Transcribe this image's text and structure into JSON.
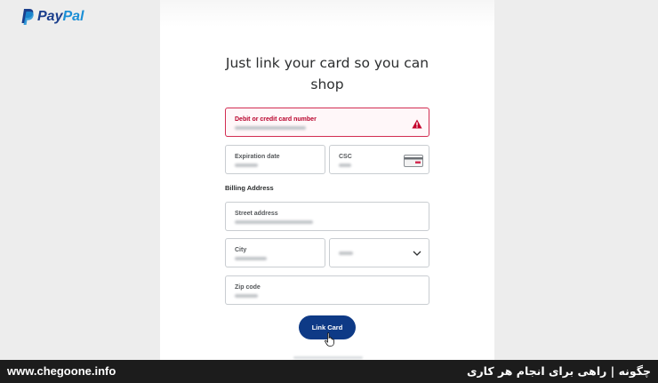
{
  "brand": {
    "name_part1": "Pay",
    "name_part2": "Pal",
    "color_dark": "#1a3e8c",
    "color_light": "#1b8fd6"
  },
  "form": {
    "heading_line1": "Just link your card so you can",
    "heading_line2": "shop",
    "card_number": {
      "label": "Debit or credit card number",
      "state": "error",
      "value_obscured": true,
      "icon": "warning-icon"
    },
    "expiration": {
      "label": "Expiration date",
      "value_obscured": true
    },
    "csc": {
      "label": "CSC",
      "value_obscured": true,
      "icon": "card-back-icon"
    },
    "billing_heading": "Billing Address",
    "street": {
      "label": "Street address",
      "value_obscured": true
    },
    "city": {
      "label": "City",
      "value_obscured": true
    },
    "state": {
      "value_obscured": true,
      "icon": "chevron-down-icon"
    },
    "zip": {
      "label": "Zip code",
      "value_obscured": true
    },
    "submit_label": "Link Card",
    "accent_color": "#0e3a86",
    "error_color": "#d22d52"
  },
  "footer": {
    "site": "www.chegoone.info",
    "tagline": "چگونه | راهی برای انجام هر کاری"
  }
}
